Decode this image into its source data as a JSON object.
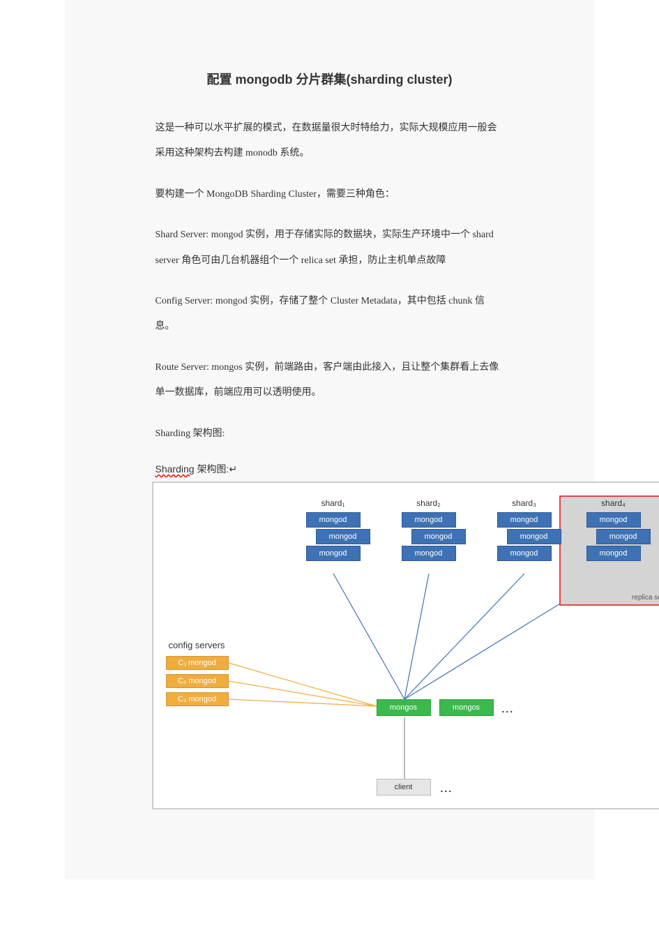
{
  "title": "配置 mongodb 分片群集(sharding cluster)",
  "p1": "这是一种可以水平扩展的模式，在数据量很大时特给力，实际大规模应用一般会采用这种架构去构建 monodb 系统。",
  "p2": "要构建一个 MongoDB Sharding Cluster，需要三种角色：",
  "p3": "Shard Server: mongod 实例，用于存储实际的数据块，实际生产环境中一个 shard server 角色可由几台机器组个一个 relica set 承担，防止主机单点故障",
  "p4": "Config Server: mongod  实例，存储了整个 Cluster Metadata，其中包括 chunk 信息。",
  "p5": "Route Server: mongos  实例，前端路由，客户端由此接入，且让整个集群看上去像单一数据库，前端应用可以透明使用。",
  "p6": "Sharding 架构图:",
  "caption_word": "Sharding",
  "caption_rest": "架构图:↵",
  "diagram": {
    "shards": [
      "shard₁",
      "shard₂",
      "shard₃",
      "shard₄"
    ],
    "mongod": "mongod",
    "replica_set": "replica set",
    "config_title": "config servers",
    "cfg": [
      "C₁ mongod",
      "C₂ mongod",
      "C₃ mongod"
    ],
    "mongos": "mongos",
    "client": "client",
    "dots": "..."
  }
}
